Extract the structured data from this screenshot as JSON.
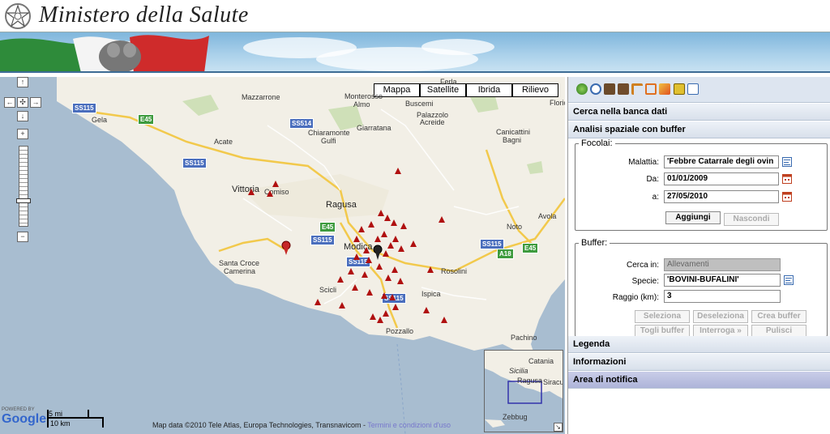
{
  "header": {
    "title": "Ministero della Salute"
  },
  "map": {
    "types": [
      "Mappa",
      "Satellite",
      "Ibrida",
      "Rilievo"
    ],
    "places": [
      {
        "name": "Mazzarrone",
        "big": false
      },
      {
        "name": "Monterosso",
        "big": false
      },
      {
        "name": "Almo",
        "big": false
      },
      {
        "name": "Buscemi",
        "big": false
      },
      {
        "name": "Palazzolo",
        "big": false
      },
      {
        "name": "Acreide",
        "big": false
      },
      {
        "name": "Ferla",
        "big": false
      },
      {
        "name": "Florio",
        "big": false
      },
      {
        "name": "Gela",
        "big": false
      },
      {
        "name": "Acate",
        "big": false
      },
      {
        "name": "Chiaramonte",
        "big": false
      },
      {
        "name": "Gulfi",
        "big": false
      },
      {
        "name": "Giarratana",
        "big": false
      },
      {
        "name": "Canicattini",
        "big": false
      },
      {
        "name": "Bagni",
        "big": false
      },
      {
        "name": "Vittoria",
        "big": true
      },
      {
        "name": "Comiso",
        "big": false
      },
      {
        "name": "Ragusa",
        "big": true
      },
      {
        "name": "Noto",
        "big": false
      },
      {
        "name": "Avola",
        "big": false
      },
      {
        "name": "Modica",
        "big": true
      },
      {
        "name": "Santa Croce",
        "big": false
      },
      {
        "name": "Camerina",
        "big": false
      },
      {
        "name": "Rosolini",
        "big": false
      },
      {
        "name": "Scicli",
        "big": false
      },
      {
        "name": "Ispica",
        "big": false
      },
      {
        "name": "Pozzallo",
        "big": false
      },
      {
        "name": "Pachino",
        "big": false
      }
    ],
    "shields": [
      "SS115",
      "E45",
      "SS514",
      "SS115",
      "E45",
      "SS115",
      "SS115",
      "E45",
      "A18",
      "SS115",
      "SS115"
    ],
    "overview": {
      "places": [
        "Catania",
        "Sicilia",
        "Ragusa",
        "Siracu",
        "Zebbug"
      ]
    },
    "scale": {
      "mi": "5 mi",
      "km": "10 km"
    },
    "powered_by": "POWERED BY",
    "google": "Google",
    "attribution": "Map data ©2010 Tele Atlas, Europa Technologies, Transnavicom - ",
    "terms_link": "Termini e condizioni d'uso"
  },
  "panel": {
    "sections": {
      "search": "Cerca nella banca dati",
      "spatial": "Analisi spaziale con buffer",
      "legend": "Legenda",
      "info": "Informazioni",
      "notify": "Area di notifica"
    },
    "focolai": {
      "legend": "Focolai:",
      "malattia_label": "Malattia:",
      "malattia_value": "'Febbre Catarrale degli ovin",
      "da_label": "Da:",
      "da_value": "01/01/2009",
      "a_label": "a:",
      "a_value": "27/05/2010",
      "aggiungi": "Aggiungi",
      "nascondi": "Nascondi"
    },
    "buffer": {
      "legend": "Buffer:",
      "cerca_label": "Cerca in:",
      "cerca_value": "Allevamenti",
      "specie_label": "Specie:",
      "specie_value": "'BOVINI-BUFALINI'",
      "raggio_label": "Raggio (km):",
      "raggio_value": "3",
      "buttons": [
        "Seleziona",
        "Deseleziona",
        "Crea buffer",
        "Togli buffer",
        "Interroga »",
        "Pulisci"
      ]
    }
  }
}
